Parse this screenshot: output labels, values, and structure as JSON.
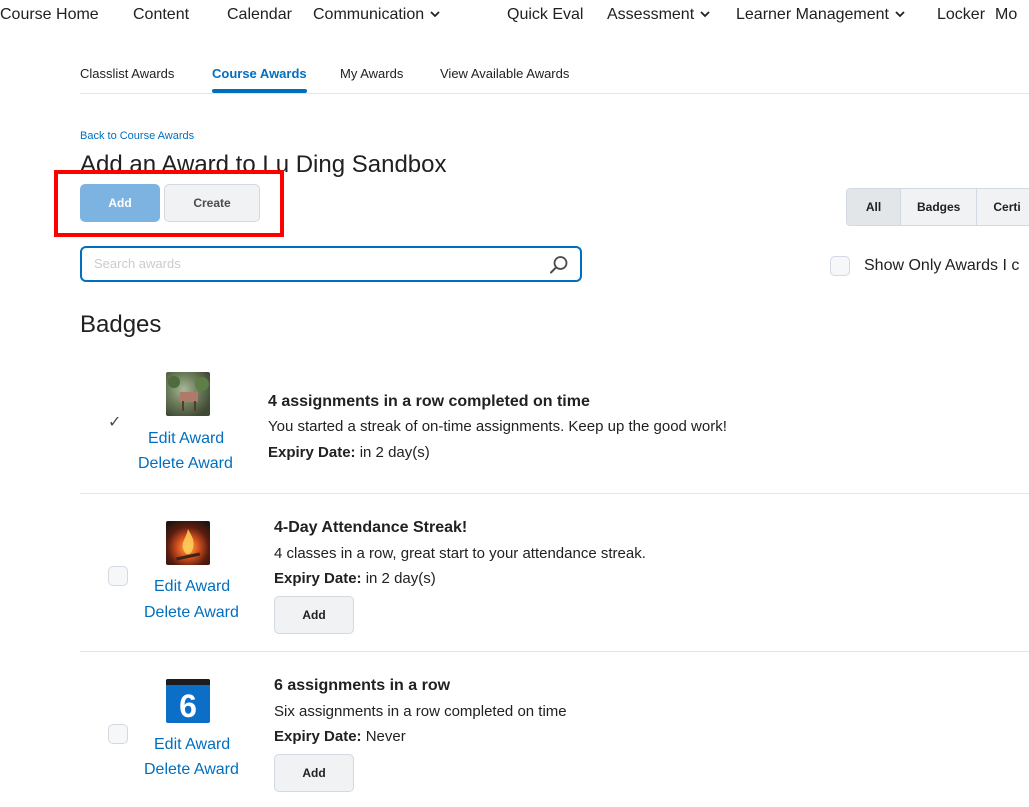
{
  "topnav": {
    "items": [
      "Course Home",
      "Content",
      "Calendar",
      "Communication",
      "Quick Eval",
      "Assessment",
      "Learner Management",
      "Locker",
      "Mo"
    ]
  },
  "tabs": [
    "Classlist Awards",
    "Course Awards",
    "My Awards",
    "View Available Awards"
  ],
  "active_tab": "Course Awards",
  "back_link": "Back to Course Awards",
  "page_title": "Add an Award to Lu Ding Sandbox",
  "buttons": {
    "add": "Add",
    "create": "Create"
  },
  "filters": [
    "All",
    "Badges",
    "Certi"
  ],
  "search": {
    "placeholder": "Search awards",
    "value": ""
  },
  "show_only_label": "Show Only Awards I c",
  "section_title": "Badges",
  "awards": [
    {
      "title": "4 assignments in a row completed on time",
      "description": "You started a streak of on-time assignments. Keep up the good work!",
      "expiry_label": "Expiry Date:",
      "expiry_value": "in 2 day(s)",
      "edit_label": "Edit Award",
      "delete_label": "Delete Award",
      "added": true,
      "add_label": "",
      "icon": "garden-photo-icon"
    },
    {
      "title": "4-Day Attendance Streak!",
      "description": "4 classes in a row, great start to your attendance streak.",
      "expiry_label": "Expiry Date:",
      "expiry_value": "in 2 day(s)",
      "edit_label": "Edit Award",
      "delete_label": "Delete Award",
      "added": false,
      "add_label": "Add",
      "icon": "campfire-photo-icon"
    },
    {
      "title": "6 assignments in a row",
      "description": "Six assignments in a row completed on time",
      "expiry_label": "Expiry Date:",
      "expiry_value": "Never",
      "edit_label": "Edit Award",
      "delete_label": "Delete Award",
      "added": false,
      "add_label": "Add",
      "icon": "number-six-icon"
    }
  ],
  "colors": {
    "link": "#006fbf",
    "primary_button": "#7db3e0",
    "highlight": "#ff0000"
  }
}
